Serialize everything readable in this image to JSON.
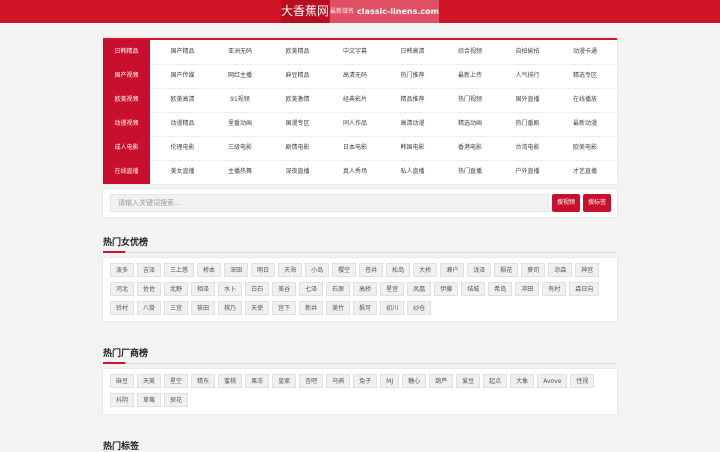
{
  "header": {
    "brand": "大香蕉网",
    "domain_label": "最新域名",
    "domain": "classic-linens.com"
  },
  "nav": {
    "rows": [
      {
        "category": "日韩精品",
        "links": [
          "国产精品",
          "亚洲无码",
          "欧美精品",
          "中文字幕",
          "日韩高清",
          "综合视频",
          "自拍偷拍",
          "动漫卡通"
        ]
      },
      {
        "category": "国产视频",
        "links": [
          "国产传媒",
          "网红主播",
          "麻豆精品",
          "高清无码",
          "热门推荐",
          "最新上传",
          "人气排行",
          "精选专区"
        ]
      },
      {
        "category": "欧美视频",
        "links": [
          "欧美高清",
          "91视频",
          "欧美激情",
          "经典影片",
          "精品推荐",
          "热门视频",
          "国外直播",
          "在线播放"
        ]
      },
      {
        "category": "动漫视频",
        "links": [
          "动漫精品",
          "里番动画",
          "国漫专区",
          "同人作品",
          "高清动漫",
          "精选动画",
          "热门番剧",
          "最新动漫"
        ]
      },
      {
        "category": "成人电影",
        "links": [
          "伦理电影",
          "三级电影",
          "剧情电影",
          "日本电影",
          "韩国电影",
          "香港电影",
          "台湾电影",
          "欧美电影"
        ]
      },
      {
        "category": "在线直播",
        "links": [
          "美女直播",
          "主播热舞",
          "深夜直播",
          "真人秀场",
          "私人直播",
          "热门直播",
          "户外直播",
          "才艺直播"
        ]
      }
    ]
  },
  "search": {
    "placeholder": "请输入关键词搜索...",
    "search_label": "搜视频",
    "tag_label": "搜标签"
  },
  "sections": [
    {
      "title": "热门女优榜",
      "tags": [
        "波多",
        "吉泽",
        "三上悠",
        "桥本",
        "深田",
        "明日",
        "天海",
        "小岛",
        "樱空",
        "苍井",
        "松岛",
        "大桥",
        "濑户",
        "泷泽",
        "枫花",
        "葵司",
        "凉森",
        "神宫",
        "河北",
        "佐佐",
        "北野",
        "相泽",
        "水卜",
        "白石",
        "美谷",
        "七泽",
        "石原",
        "高桥",
        "星宫",
        "凤凰",
        "伊藤",
        "结城",
        "希岛",
        "冲田",
        "有村",
        "森日向",
        "铃村",
        "八掛",
        "三宫",
        "筱田",
        "桃乃",
        "天使",
        "宫下",
        "新井",
        "美竹",
        "枫可",
        "初川",
        "纱仓"
      ]
    },
    {
      "title": "热门厂商榜",
      "tags": [
        "麻豆",
        "天美",
        "星空",
        "精东",
        "蜜桃",
        "果冻",
        "皇家",
        "杏吧",
        "乌鸦",
        "兔子",
        "MJ",
        "糖心",
        "葫芦",
        "爱豆",
        "起点",
        "大象",
        "Avove",
        "性视",
        "抖阴",
        "草莓",
        "探花"
      ]
    },
    {
      "title": "热门标签",
      "tags": []
    }
  ]
}
